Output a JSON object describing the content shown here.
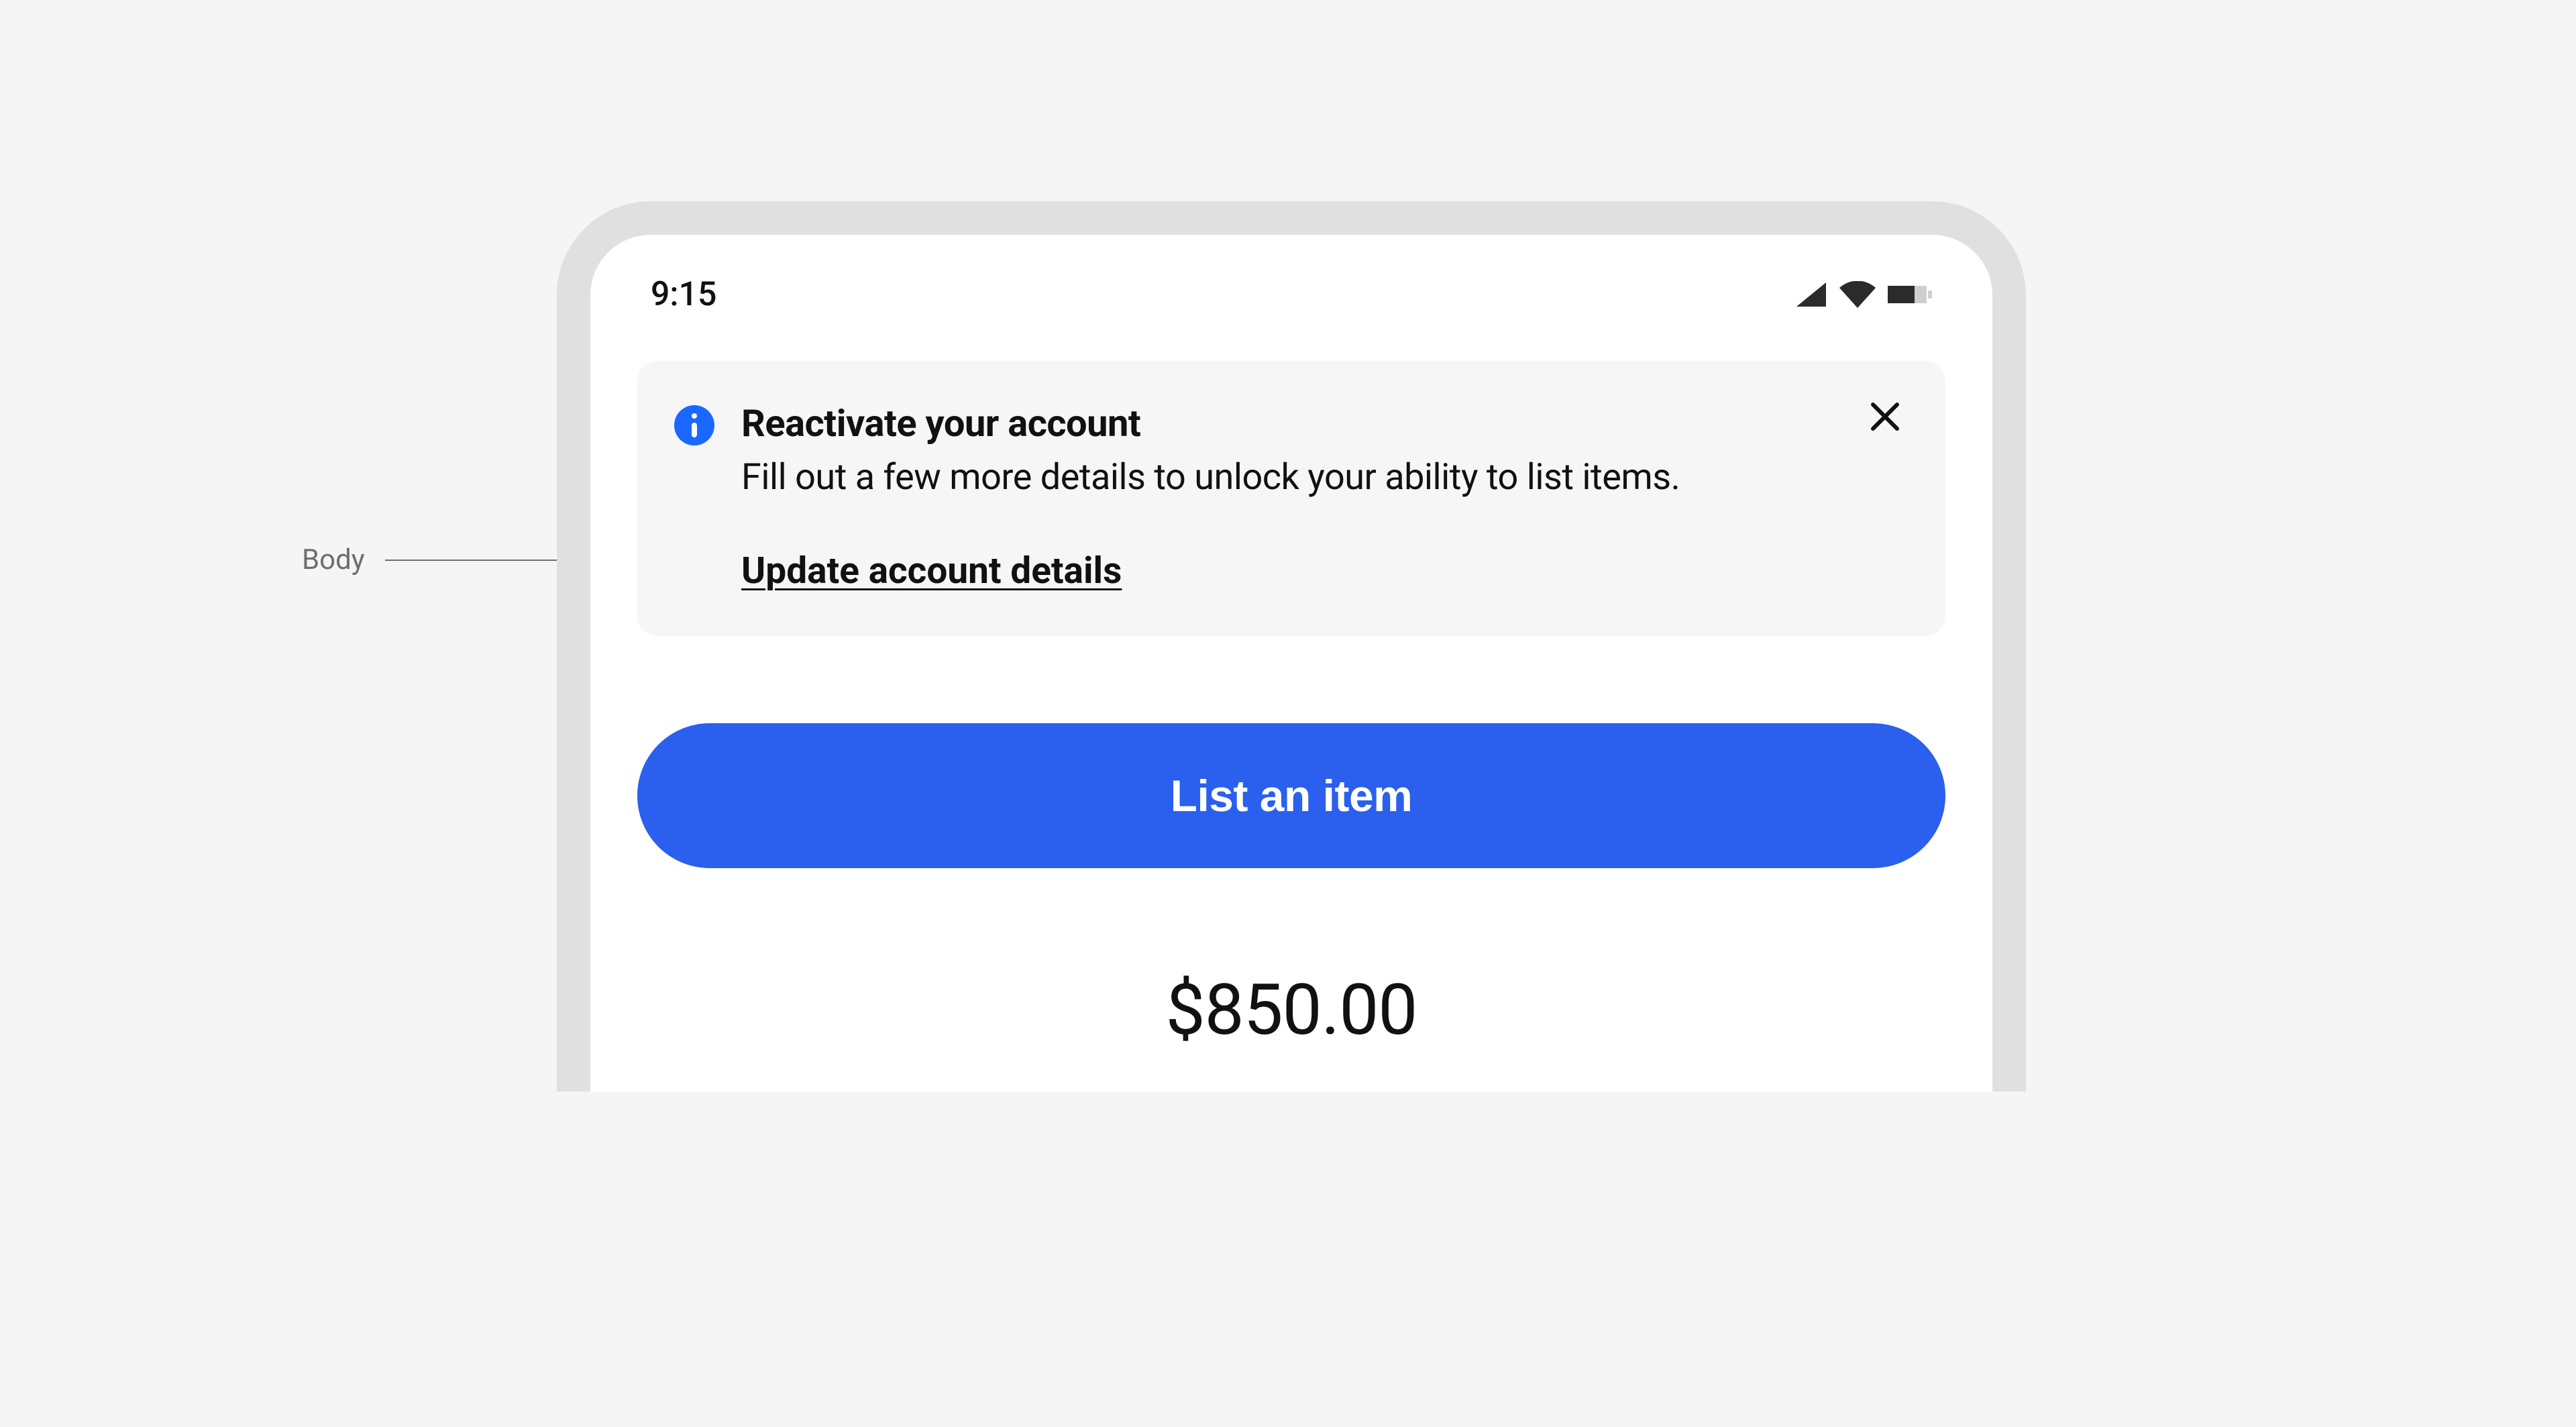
{
  "annotation": {
    "label": "Body"
  },
  "statusbar": {
    "time": "9:15"
  },
  "notice": {
    "title": "Reactivate your account",
    "body": "Fill out a few more details to unlock your ability to list items.",
    "link_label": "Update account details"
  },
  "actions": {
    "primary_label": "List an item"
  },
  "summary": {
    "amount": "$850.00"
  },
  "colors": {
    "accent": "#2b5fed",
    "info_icon": "#1a68ff",
    "notice_bg": "#f6f6f6",
    "page_bg": "#f5f5f5"
  }
}
